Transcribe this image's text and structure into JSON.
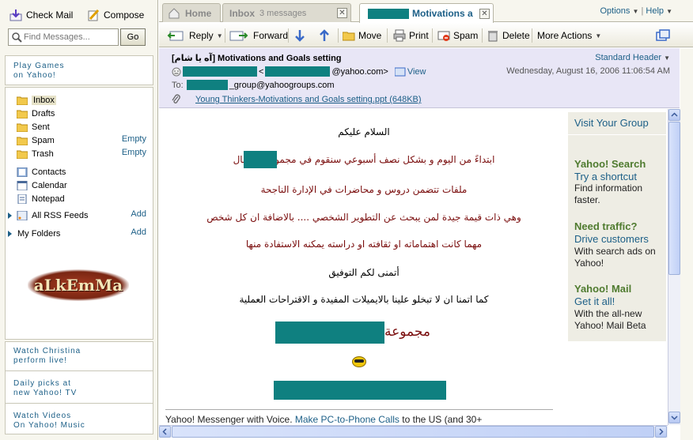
{
  "left": {
    "check_mail": "Check Mail",
    "compose": "Compose",
    "search_placeholder": "Find Messages...",
    "go": "Go",
    "promo_top": [
      "Play Games",
      "on Yahoo!"
    ],
    "folders": [
      {
        "label": "Inbox",
        "action": ""
      },
      {
        "label": "Drafts",
        "action": ""
      },
      {
        "label": "Sent",
        "action": ""
      },
      {
        "label": "Spam",
        "action": "Empty"
      },
      {
        "label": "Trash",
        "action": "Empty"
      },
      {
        "label": "Contacts",
        "action": ""
      },
      {
        "label": "Calendar",
        "action": ""
      },
      {
        "label": "Notepad",
        "action": ""
      },
      {
        "label": "All RSS Feeds",
        "action": "Add"
      },
      {
        "label": "My Folders",
        "action": "Add"
      }
    ],
    "logo_text": "aLkEmMa",
    "promos_bottom": [
      [
        "Watch Christina",
        "perform live!"
      ],
      [
        "Daily picks at",
        "new Yahoo! TV"
      ],
      [
        "Watch Videos",
        "On Yahoo! Music"
      ]
    ]
  },
  "tabs": {
    "home": "Home",
    "inbox": "Inbox",
    "inbox_count": "3 messages",
    "active_suffix": "Motivations a",
    "options": "Options",
    "help": "Help"
  },
  "toolbar": {
    "reply": "Reply",
    "forward": "Forward",
    "move": "Move",
    "print": "Print",
    "spam": "Spam",
    "delete": "Delete",
    "more_actions": "More Actions"
  },
  "message": {
    "subject": "[آه يا شام] Motivations and Goals setting",
    "standard_header": "Standard Header",
    "from_suffix": "@yahoo.com>",
    "view": "View",
    "date": "Wednesday, August 16, 2006 11:06:54 AM",
    "to_label": "To:",
    "to_suffix": "_group@yahoogroups.com",
    "attachment": "Young Thinkers-Motivations and Goals setting.ppt (648KB)"
  },
  "body": {
    "greeting": "السلام عليكم",
    "line1": "ابتداءً من اليوم و بشكل نصف أسبوعي سنقوم في مجموعة            بإرسال",
    "line2": "ملفات تتضمن دروس و محاضرات في الإدارة الناجحة",
    "line3": "وهي ذات قيمة جيدة لمن يبحث عن التطوير الشخصي .... بالاضافة ان كل شخص",
    "line4": "مهما كانت اهتماماته او ثقافته او دراسته يمكنه الاستفادة منها",
    "line5": "أتمنى لكم التوفيق",
    "line6": "كما اتمنا ان لا تبخلو علينا بالايميلات المفيدة و الاقتراحات العملية",
    "group_word": "مجموعة",
    "footer_prefix": "Yahoo! Messenger with Voice. ",
    "footer_link": "Make PC-to-Phone Calls",
    "footer_suffix": " to the US (and 30+"
  },
  "ads": {
    "visit": "Visit Your Group",
    "blocks": [
      {
        "title": "Yahoo! Search",
        "link": "Try a shortcut",
        "text": "Find information faster."
      },
      {
        "title": "Need traffic?",
        "link": "Drive customers",
        "text": "With search ads on Yahoo!"
      },
      {
        "title": "Yahoo! Mail",
        "link": "Get it all!",
        "text": "With the all-new Yahoo! Mail Beta"
      }
    ]
  },
  "colors": {
    "link": "#1c5f87",
    "redaction": "#0f8080",
    "ad_title": "#4f7b2f",
    "arabic_text": "#7a0d0d"
  }
}
